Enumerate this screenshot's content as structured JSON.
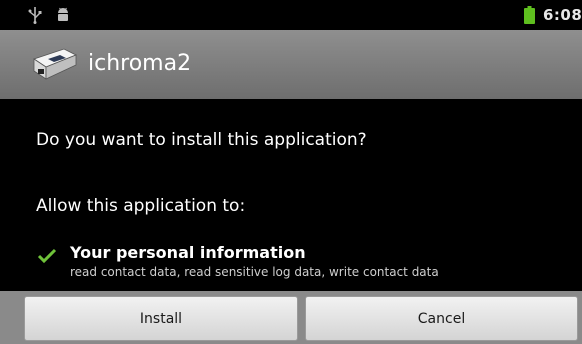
{
  "status_bar": {
    "time": "6:08",
    "icons": [
      "usb-icon",
      "android-debug-icon",
      "battery-icon"
    ],
    "battery_color": "#5fbf1f"
  },
  "title_bar": {
    "app_name": "ichroma2",
    "icon": "app-device-icon"
  },
  "content": {
    "prompt": "Do you want to install this application?",
    "allow_label": "Allow this application to:",
    "permissions": [
      {
        "icon": "check-icon",
        "title": "Your personal information",
        "detail": "read contact data, read sensitive log data, write contact data"
      }
    ]
  },
  "buttons": {
    "install": "Install",
    "cancel": "Cancel"
  }
}
